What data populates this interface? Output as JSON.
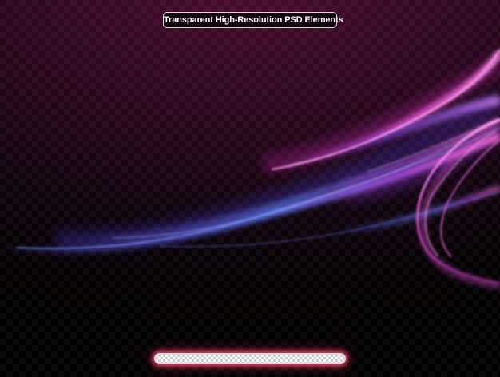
{
  "badge": {
    "text": "Transparent High-Resolution PSD Elements"
  },
  "colors": {
    "background_top": "#4a0c2e",
    "background_bottom": "#020002",
    "smoke_magenta": "#e040c8",
    "smoke_pink": "#ff6ad8",
    "smoke_blue": "#4a5cf0",
    "smoke_violet": "#8a3cf0",
    "bar_glow": "#ff5a78"
  },
  "icons": {
    "smoke": "smoke-wave-graphic",
    "bar": "transparency-checker-bar"
  }
}
